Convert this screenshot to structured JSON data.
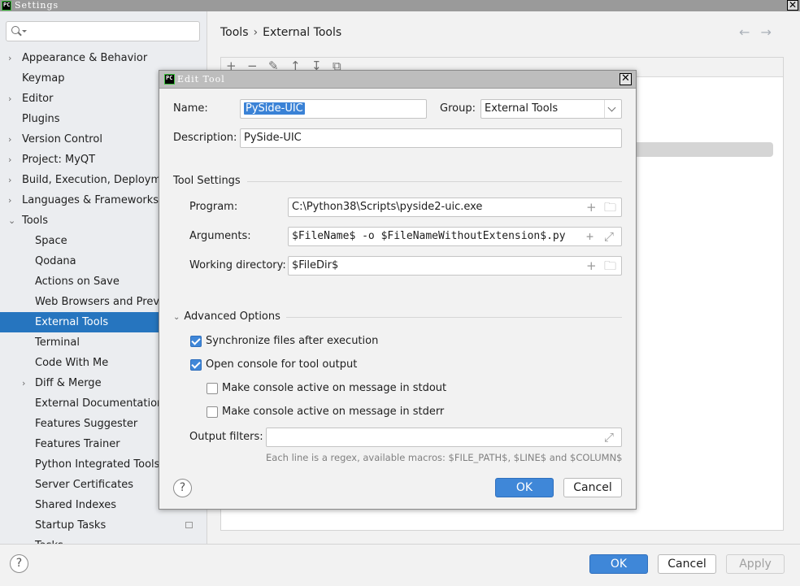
{
  "window": {
    "title": "Settings",
    "logo_text": "PC"
  },
  "search": {
    "placeholder": ""
  },
  "sidebar": {
    "items": [
      {
        "label": "Appearance & Behavior",
        "arrow": "›"
      },
      {
        "label": "Keymap",
        "arrow": ""
      },
      {
        "label": "Editor",
        "arrow": "›"
      },
      {
        "label": "Plugins",
        "arrow": ""
      },
      {
        "label": "Version Control",
        "arrow": "›"
      },
      {
        "label": "Project: MyQT",
        "arrow": "›"
      },
      {
        "label": "Build, Execution, Deployment",
        "arrow": "›"
      },
      {
        "label": "Languages & Frameworks",
        "arrow": "›"
      },
      {
        "label": "Tools",
        "arrow": "⌄"
      },
      {
        "label": "Space",
        "arrow": ""
      },
      {
        "label": "Qodana",
        "arrow": ""
      },
      {
        "label": "Actions on Save",
        "arrow": ""
      },
      {
        "label": "Web Browsers and Preview",
        "arrow": ""
      },
      {
        "label": "External Tools",
        "arrow": ""
      },
      {
        "label": "Terminal",
        "arrow": ""
      },
      {
        "label": "Code With Me",
        "arrow": ""
      },
      {
        "label": "Diff & Merge",
        "arrow": "›"
      },
      {
        "label": "External Documentation",
        "arrow": ""
      },
      {
        "label": "Features Suggester",
        "arrow": ""
      },
      {
        "label": "Features Trainer",
        "arrow": ""
      },
      {
        "label": "Python Integrated Tools",
        "arrow": ""
      },
      {
        "label": "Server Certificates",
        "arrow": ""
      },
      {
        "label": "Shared Indexes",
        "arrow": ""
      },
      {
        "label": "Startup Tasks",
        "arrow": ""
      },
      {
        "label": "Tasks",
        "arrow": "›"
      }
    ],
    "selected": "External Tools"
  },
  "breadcrumb": {
    "root": "Tools",
    "separator": "›",
    "current": "External Tools"
  },
  "nav": {
    "back": "←",
    "forward": "→"
  },
  "toolstrip": {
    "add": "+",
    "remove": "−",
    "edit": "✎",
    "up": "↑",
    "down": "↧",
    "copy": "⧉"
  },
  "dialog": {
    "title": "Edit Tool",
    "name_label": "Name:",
    "name_value": "PySide-UIC",
    "group_label": "Group:",
    "group_value": "External Tools",
    "description_label": "Description:",
    "description_value": "PySide-UIC",
    "tool_settings": {
      "heading": "Tool Settings",
      "program_label": "Program:",
      "program_value": "C:\\Python38\\Scripts\\pyside2-uic.exe",
      "arguments_label": "Arguments:",
      "arguments_value": "$FileName$ -o $FileNameWithoutExtension$.py",
      "workdir_label": "Working directory:",
      "workdir_value": "$FileDir$"
    },
    "advanced": {
      "heading": "Advanced Options",
      "sync_label": "Synchronize files after execution",
      "sync_checked": true,
      "console_label": "Open console for tool output",
      "console_checked": true,
      "stdout_label": "Make console active on message in stdout",
      "stdout_checked": false,
      "stderr_label": "Make console active on message in stderr",
      "stderr_checked": false,
      "filters_label": "Output filters:",
      "filters_value": "",
      "hint": "Each line is a regex, available macros: $FILE_PATH$, $LINE$ and $COLUMN$"
    },
    "ok": "OK",
    "cancel": "Cancel",
    "help": "?"
  },
  "footer": {
    "help": "?",
    "ok": "OK",
    "cancel": "Cancel",
    "apply": "Apply"
  },
  "colors": {
    "accent": "#3f87d8",
    "selection": "#2675bf"
  }
}
